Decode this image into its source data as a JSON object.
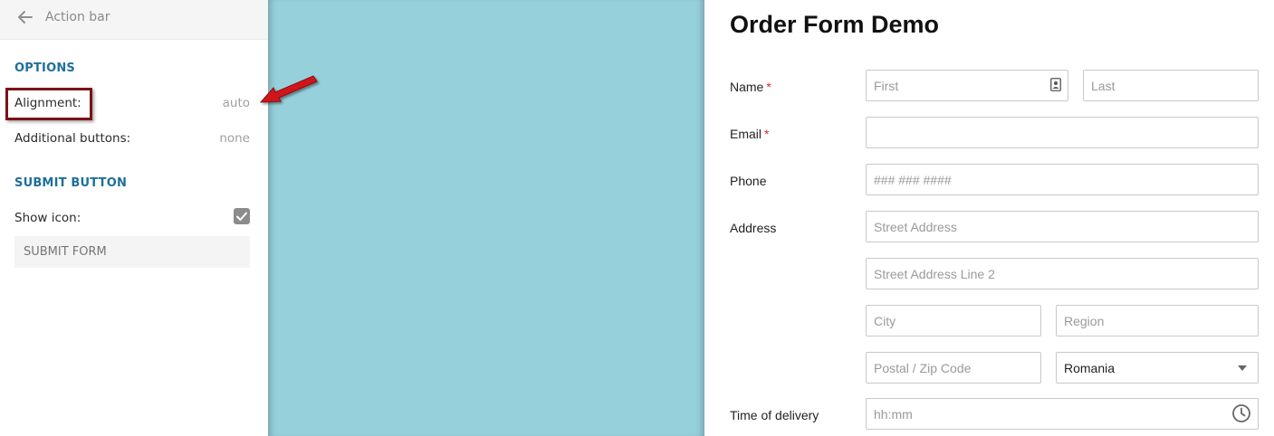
{
  "panel": {
    "title": "Action bar",
    "options_heading": "OPTIONS",
    "alignment_label": "Alignment:",
    "alignment_value": "auto",
    "additional_label": "Additional buttons:",
    "additional_value": "none",
    "submit_heading": "SUBMIT BUTTON",
    "show_icon_label": "Show icon:",
    "show_icon_checked": true,
    "submit_text_placeholder": "SUBMIT FORM"
  },
  "colors": {
    "accent": "#1f6f9a",
    "teal_background": "#96d0db",
    "highlight_border": "#7a1418",
    "arrow": "#d0161b",
    "required": "#d32f2f"
  },
  "form": {
    "title": "Order Form Demo",
    "name_label": "Name",
    "email_label": "Email",
    "phone_label": "Phone",
    "address_label": "Address",
    "delivery_label": "Time of delivery",
    "required_mark": "*",
    "first_placeholder": "First",
    "last_placeholder": "Last",
    "phone_placeholder": "### ### ####",
    "street_placeholder": "Street Address",
    "street2_placeholder": "Street Address Line 2",
    "city_placeholder": "City",
    "region_placeholder": "Region",
    "zip_placeholder": "Postal / Zip Code",
    "country_value": "Romania",
    "time_placeholder": "hh:mm"
  }
}
